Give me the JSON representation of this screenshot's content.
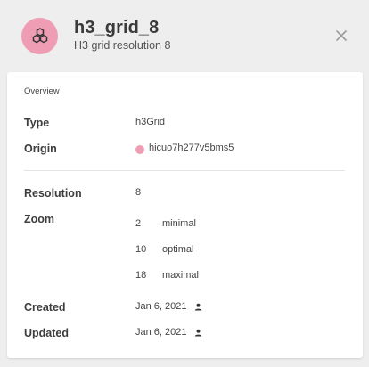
{
  "header": {
    "title": "h3_grid_8",
    "subtitle": "H3 grid resolution 8",
    "avatar_icon": "hexagon-cluster-icon",
    "close_icon": "close-icon",
    "avatar_color": "#ee9db4"
  },
  "overview": {
    "section_title": "Overview",
    "type": {
      "label": "Type",
      "value": "h3Grid"
    },
    "origin": {
      "label": "Origin",
      "value": "hicuo7h277v5bms5",
      "dot_color": "#ee9db4"
    },
    "resolution": {
      "label": "Resolution",
      "value": "8"
    },
    "zoom": {
      "label": "Zoom",
      "levels": [
        {
          "value": "2",
          "name": "minimal"
        },
        {
          "value": "10",
          "name": "optimal"
        },
        {
          "value": "18",
          "name": "maximal"
        }
      ]
    },
    "created": {
      "label": "Created",
      "value": "Jan 6, 2021",
      "icon": "person-icon"
    },
    "updated": {
      "label": "Updated",
      "value": "Jan 6, 2021",
      "icon": "person-icon"
    }
  }
}
